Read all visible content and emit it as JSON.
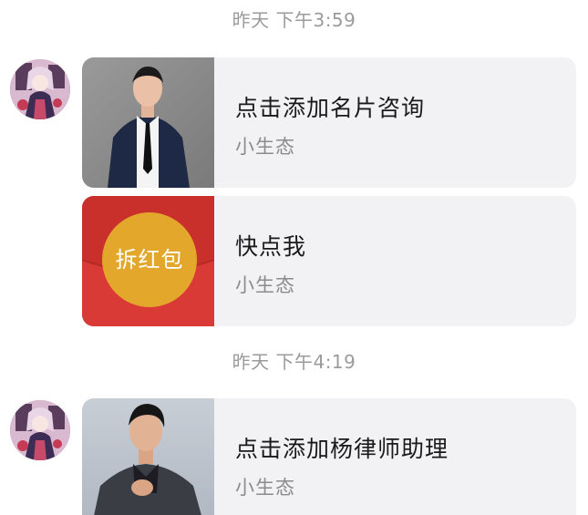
{
  "messages": [
    {
      "timestamp": "昨天 下午3:59",
      "cards": [
        {
          "type": "contact-card",
          "title": "点击添加名片咨询",
          "subtitle": "小生态",
          "thumbnail_icon": "man-in-suit-photo"
        },
        {
          "type": "red-packet",
          "title": "快点我",
          "subtitle": "小生态",
          "packet_label": "拆红包"
        }
      ]
    },
    {
      "timestamp": "昨天 下午4:19",
      "cards": [
        {
          "type": "contact-card",
          "title": "点击添加杨律师助理",
          "subtitle": "小生态",
          "thumbnail_icon": "man-in-suit-photo"
        }
      ]
    }
  ],
  "colors": {
    "card_background": "#f2f2f4",
    "timestamp_text": "#9b9b9b",
    "title_text": "#1a1a1a",
    "subtitle_text": "#8c8c8c",
    "red_packet_red": "#d93a35",
    "red_packet_gold": "#e3a72c"
  }
}
